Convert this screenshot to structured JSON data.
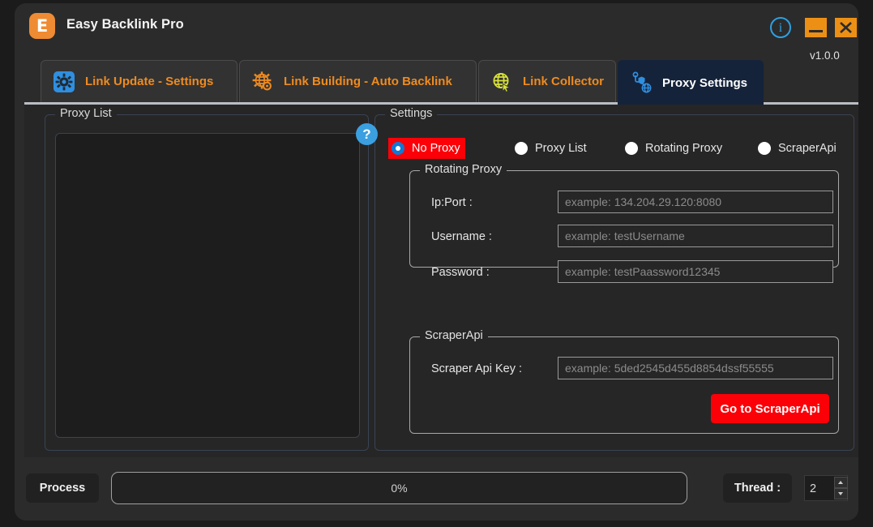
{
  "window": {
    "logo_letter": "E",
    "title": "Easy Backlink Pro",
    "version": "v1.0.0",
    "info_glyph": "i"
  },
  "tabs": [
    {
      "id": "link-update",
      "label": "Link Update - Settings",
      "icon": "gear-settings-icon",
      "active": false
    },
    {
      "id": "link-building",
      "label": "Link Building - Auto Backlink",
      "icon": "gear-globe-icon",
      "active": false
    },
    {
      "id": "link-collector",
      "label": "Link Collector",
      "icon": "globe-cursor-icon",
      "active": false
    },
    {
      "id": "proxy-settings",
      "label": "Proxy Settings",
      "icon": "proxy-network-icon",
      "active": true
    }
  ],
  "proxy_list_panel": {
    "title": "Proxy List",
    "textarea_value": "",
    "help_glyph": "?"
  },
  "settings_panel": {
    "title": "Settings",
    "proxy_modes": [
      {
        "id": "no-proxy",
        "label": "No Proxy",
        "selected": true
      },
      {
        "id": "proxy-list",
        "label": "Proxy List",
        "selected": false
      },
      {
        "id": "rotating-proxy",
        "label": "Rotating Proxy",
        "selected": false
      },
      {
        "id": "scraper-api",
        "label": "ScraperApi",
        "selected": false
      }
    ],
    "rotating_proxy": {
      "title": "Rotating Proxy",
      "help_glyph": "?",
      "fields": [
        {
          "id": "ip-port",
          "label": "Ip:Port :",
          "value": "",
          "placeholder": "example: 134.204.29.120:8080"
        },
        {
          "id": "username",
          "label": "Username :",
          "value": "",
          "placeholder": "example: testUsername"
        },
        {
          "id": "password",
          "label": "Password :",
          "value": "",
          "placeholder": "example: testPaassword12345"
        }
      ]
    },
    "scraper_api": {
      "title": "ScraperApi",
      "help_glyph": "?",
      "field": {
        "id": "scraper-api-key",
        "label": "Scraper Api Key :",
        "value": "",
        "placeholder": "example: 5ded2545d455d8854dssf55555"
      },
      "button_label": "Go to ScraperApi"
    }
  },
  "bottom_bar": {
    "process_label": "Process",
    "progress_text": "0%",
    "progress_percent": 0,
    "thread_label": "Thread :",
    "thread_value": "2"
  },
  "colors": {
    "accent_orange": "#ef8b1f",
    "accent_red": "#fb0007",
    "accent_blue": "#3ba0e0",
    "active_tab_bg": "#15233a",
    "window_bg": "#2b2b2b",
    "content_bg": "#262626",
    "titlebar_button": "#ec9015"
  }
}
